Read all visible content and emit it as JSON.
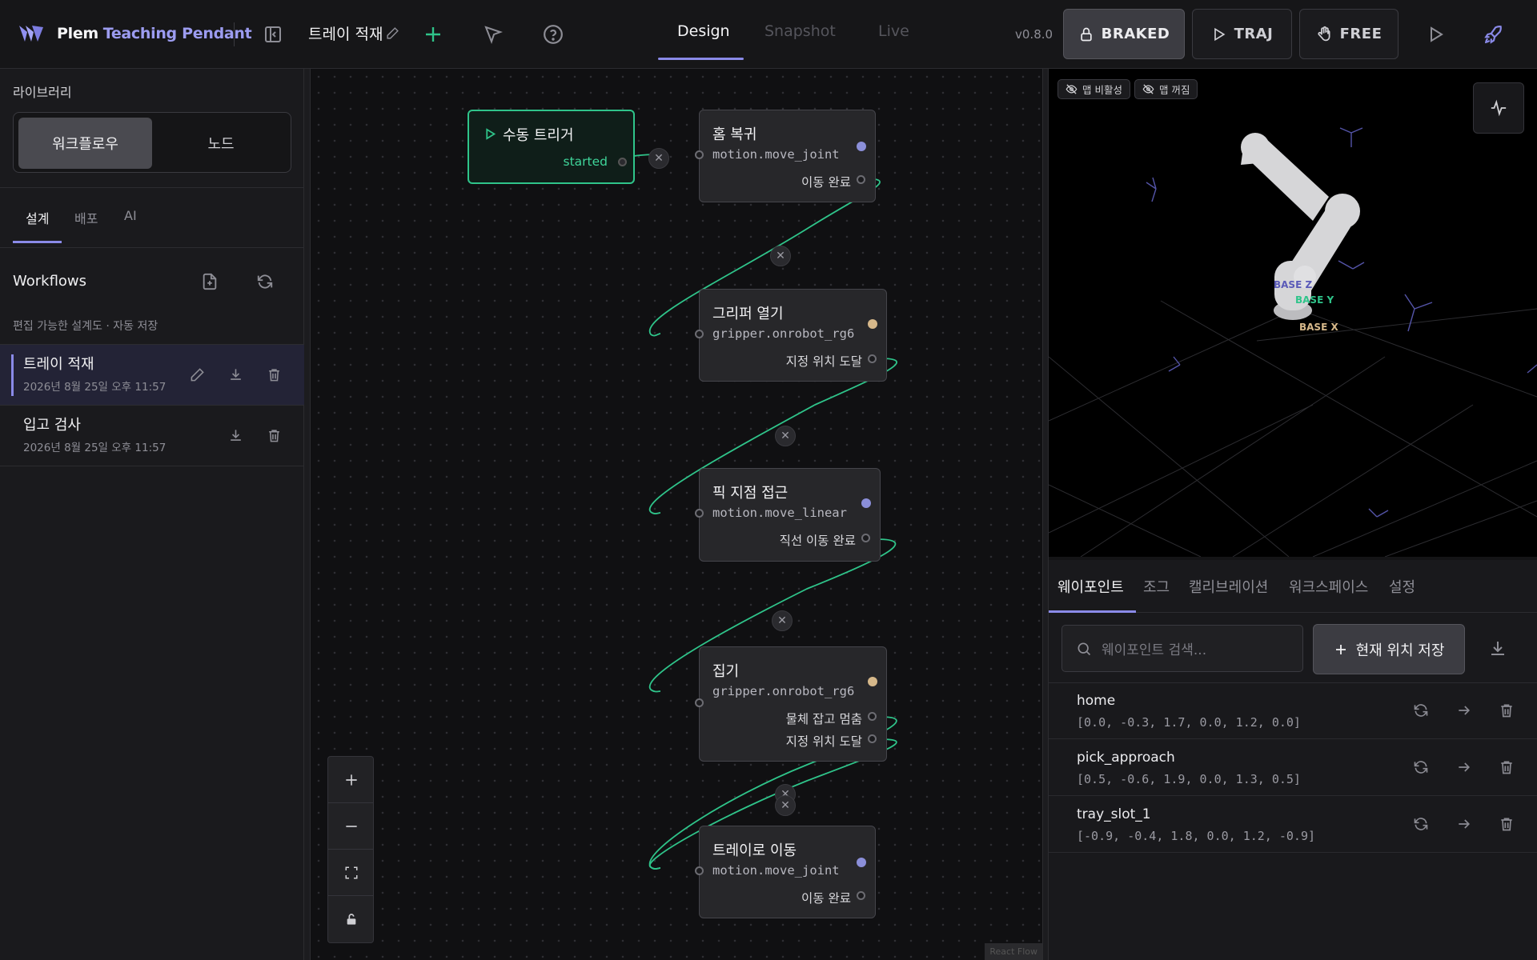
{
  "app": {
    "brand": "Plem",
    "subtitle": "Teaching Pendant",
    "version": "v0.8.0"
  },
  "header": {
    "workflow_title": "트레이 적재",
    "tabs": [
      {
        "label": "Design",
        "active": true
      },
      {
        "label": "Snapshot",
        "active": false
      },
      {
        "label": "Live",
        "active": false
      }
    ],
    "modes": {
      "braked": "BRAKED",
      "traj": "TRAJ",
      "free": "FREE"
    }
  },
  "sidebar": {
    "section_title": "라이브러리",
    "segment": [
      "워크플로우",
      "노드"
    ],
    "tabs": [
      "설계",
      "배포",
      "AI"
    ],
    "workflows_title": "Workflows",
    "hint": "편집 가능한 설계도 · 자동 저장",
    "items": [
      {
        "name": "트레이 적재",
        "date": "2026년 8월 25일 오후 11:57",
        "selected": true
      },
      {
        "name": "입고 검사",
        "date": "2026년 8월 25일 오후 11:57",
        "selected": false
      }
    ]
  },
  "canvas": {
    "trigger": {
      "title": "수동 트리거",
      "output": "started"
    },
    "nodes": [
      {
        "title": "홈 복귀",
        "type": "motion.move_joint",
        "outputs": [
          "이동 완료"
        ],
        "color": "#8b8fd9"
      },
      {
        "title": "그리퍼 열기",
        "type": "gripper.onrobot_rg6",
        "outputs": [
          "지정 위치 도달"
        ],
        "color": "#d6b88a"
      },
      {
        "title": "픽 지점 접근",
        "type": "motion.move_linear",
        "outputs": [
          "직선 이동 완료"
        ],
        "color": "#8b8fd9"
      },
      {
        "title": "집기",
        "type": "gripper.onrobot_rg6",
        "outputs": [
          "물체 잡고 멈춤",
          "지정 위치 도달"
        ],
        "color": "#d6b88a"
      },
      {
        "title": "트레이로 이동",
        "type": "motion.move_joint",
        "outputs": [
          "이동 완료"
        ],
        "color": "#8b8fd9"
      }
    ],
    "attribution": "React Flow",
    "edge_color": "#2fc48a"
  },
  "viewer": {
    "badges": [
      "맵 비활성",
      "맵 꺼짐"
    ],
    "axes": {
      "z": "BASE Z",
      "y": "BASE Y",
      "x": "BASE X"
    }
  },
  "waypoints": {
    "tabs": [
      "웨이포인트",
      "조그",
      "캘리브레이션",
      "워크스페이스",
      "설정"
    ],
    "search_placeholder": "웨이포인트 검색...",
    "save_label": "현재 위치 저장",
    "items": [
      {
        "name": "home",
        "values": "[0.0, -0.3, 1.7, 0.0, 1.2, 0.0]"
      },
      {
        "name": "pick_approach",
        "values": "[0.5, -0.6, 1.9, 0.0, 1.3, 0.5]"
      },
      {
        "name": "tray_slot_1",
        "values": "[-0.9, -0.4, 1.8, 0.0, 1.2, -0.9]"
      }
    ]
  }
}
